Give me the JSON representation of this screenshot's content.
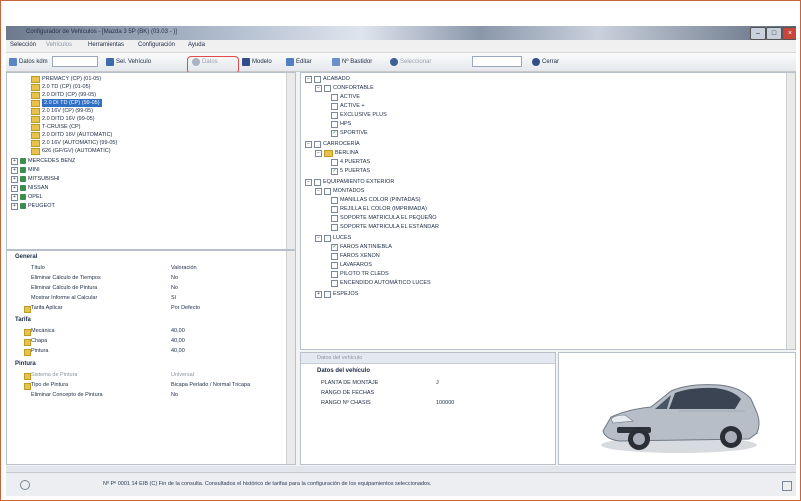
{
  "window": {
    "title": "Configurador de Vehículos - [Mazda 3 5P (BK) (03.03 - )]"
  },
  "menu": [
    "Selección",
    "Vehículos",
    "Herramientas",
    "Configuración",
    "Ayuda"
  ],
  "toolbar": {
    "search_label": "Datos kdm",
    "new_label": "Sel. Vehículo",
    "highlighted_label": "Datos",
    "update_label": "Modelo",
    "print_label": "Editar",
    "find_label": "Nº Bastidor",
    "other_label": "Seleccionar",
    "close_label": "Cerrar"
  },
  "model_tree": {
    "models": [
      "PREMACY (CP) (01-05)",
      "2.0 TD (CP) (01-05)",
      "2.0 DITD (CP) (99-05)",
      "2.0 DI TD (CP) (99-05)",
      "2.0 16V (CP) (99-05)",
      "2.0 DITD 16V (99-05)",
      "T-CRUISE (CP)",
      "2.0 DITD 16V (AUTOMATIC)",
      "2.0 16V (AUTOMATIC) (99-05)",
      "626 (GF/GV) (AUTOMATIC)"
    ],
    "selected_index": 3,
    "brands": [
      "MERCEDES BENZ",
      "MINI",
      "MITSUBISHI",
      "NISSAN",
      "OPEL",
      "PEUGEOT"
    ]
  },
  "properties": {
    "general_section": "General",
    "general_items": [
      {
        "name": "Título",
        "value": "Valoración"
      },
      {
        "name": "Eliminar Cálculo de Tiempos",
        "value": "No"
      },
      {
        "name": "Eliminar Cálculo de Pintura",
        "value": "No"
      },
      {
        "name": "Mostrar Informe al Calcular",
        "value": "Sí"
      },
      {
        "name": "Tarifa Aplicar",
        "value": "Por Defecto"
      }
    ],
    "tarifa_section": "Tarifa",
    "tarifa_items": [
      {
        "name": "Mecánica",
        "value": "40,00"
      },
      {
        "name": "Chapa",
        "value": "40,00"
      },
      {
        "name": "Pintura",
        "value": "40,00"
      }
    ],
    "pintura_section": "Pintura",
    "pintura_items": [
      {
        "name": "Sistema de Pintura",
        "value": "Universal"
      },
      {
        "name": "Tipo de Pintura",
        "value": "Bicapa Perlado / Normal Tricapa"
      },
      {
        "name": "Eliminar Concepto de Pintura",
        "value": "No"
      }
    ]
  },
  "equipment_tree": {
    "root": "ACABADO",
    "groups": [
      {
        "label": "CONFORTABLE",
        "level": 1
      },
      {
        "label": "ACTIVE",
        "level": 2,
        "checked": false
      },
      {
        "label": "ACTIVE +",
        "level": 2,
        "checked": false
      },
      {
        "label": "EXCLUSIVE PLUS",
        "level": 2,
        "checked": false
      },
      {
        "label": "HPS",
        "level": 2,
        "checked": false
      },
      {
        "label": "SPORTIVE",
        "level": 2,
        "checked": true
      },
      {
        "label": "CARROCERÍA",
        "level": 0
      },
      {
        "label": "BERLINA",
        "level": 1
      },
      {
        "label": "4 PUERTAS",
        "level": 2,
        "checked": false
      },
      {
        "label": "5 PUERTAS",
        "level": 2,
        "checked": true
      },
      {
        "label": "EQUIPAMIENTO EXTERIOR",
        "level": 0
      },
      {
        "label": "MONTADOS",
        "level": 1
      },
      {
        "label": "MANILLAS COLOR (PINTADAS)",
        "level": 2,
        "checked": false
      },
      {
        "label": "REJILLA EL COLOR (IMPRIMADA)",
        "level": 2,
        "checked": false
      },
      {
        "label": "SOPORTE MATRICULA EL PEQUEÑO",
        "level": 2,
        "checked": false
      },
      {
        "label": "SOPORTE MATRICULA EL ESTÁNDAR",
        "level": 2,
        "checked": false
      },
      {
        "label": "LUCES",
        "level": 1
      },
      {
        "label": "FAROS ANTINIEBLA",
        "level": 2,
        "checked": true
      },
      {
        "label": "FAROS XENON",
        "level": 2,
        "checked": false
      },
      {
        "label": "LAVAFAROS",
        "level": 2,
        "checked": false
      },
      {
        "label": "PILOTO TR CLEDS",
        "level": 2,
        "checked": false
      },
      {
        "label": "ENCENDIDO AUTOMÁTICO LUCES",
        "level": 2,
        "checked": false
      },
      {
        "label": "ESPEJOS",
        "level": 1
      }
    ]
  },
  "vehicle_data": {
    "tab_label": "Datos del vehículo",
    "section_title": "Datos del vehículo",
    "rows": [
      {
        "label": "PLANTA DE MONTAJE",
        "value": "J"
      },
      {
        "label": "RANGO DE FECHAS",
        "value": ""
      },
      {
        "label": "RANGO Nº CHASIS",
        "value": "100000"
      }
    ]
  },
  "status": {
    "text": "Nº Pº 0001 14 EIB (C) Fin de la consulta. Consultados el histórico de tarifas para la configuración de los equipamientos seleccionados."
  },
  "colors": {
    "accent": "#2f6fc6",
    "highlight_ring": "#e04a4a",
    "frame": "#c8643c"
  }
}
